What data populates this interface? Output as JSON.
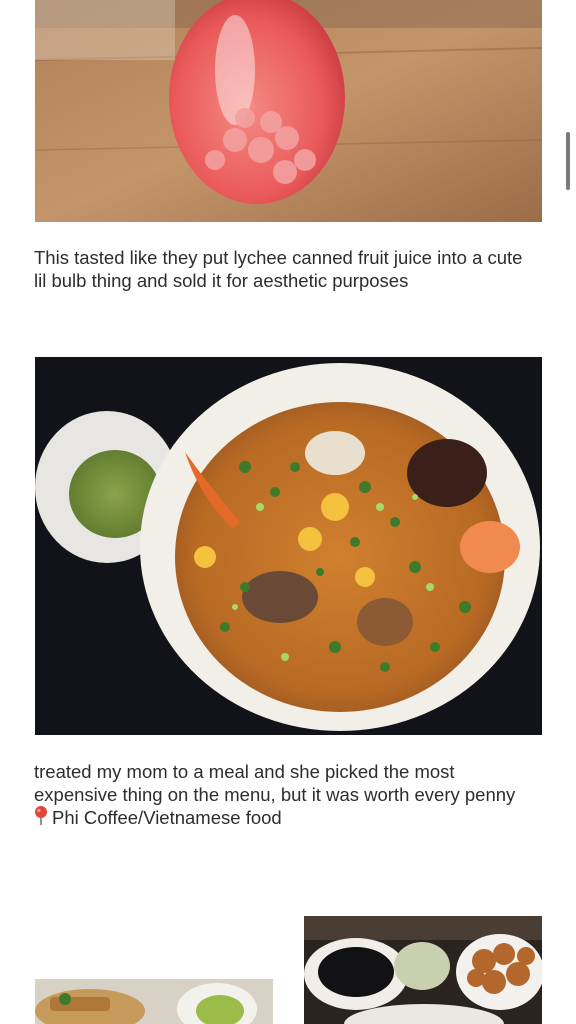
{
  "posts": [
    {
      "image_alt": "lychee drink in bulb bottle",
      "caption": "This tasted like they put lychee canned fruit juice into a cute lil bulb thing and sold it for aesthetic purposes"
    },
    {
      "image_alt": "bowl of seafood noodle soup with side sauce",
      "caption": "treated my mom to a meal and she picked the most expensive thing on the menu, but it was worth every penny",
      "location_icon": "location-pin-icon",
      "location": "Phi Coffee/Vietnamese food"
    }
  ],
  "gallery": [
    {
      "image_alt": "fried rolls with greens and guacamole"
    },
    {
      "image_alt": "table with black sauce bowl and fried dish"
    }
  ],
  "colors": {
    "accent_pin": "#e0453a",
    "scrollbar": "#7a7a7a"
  }
}
